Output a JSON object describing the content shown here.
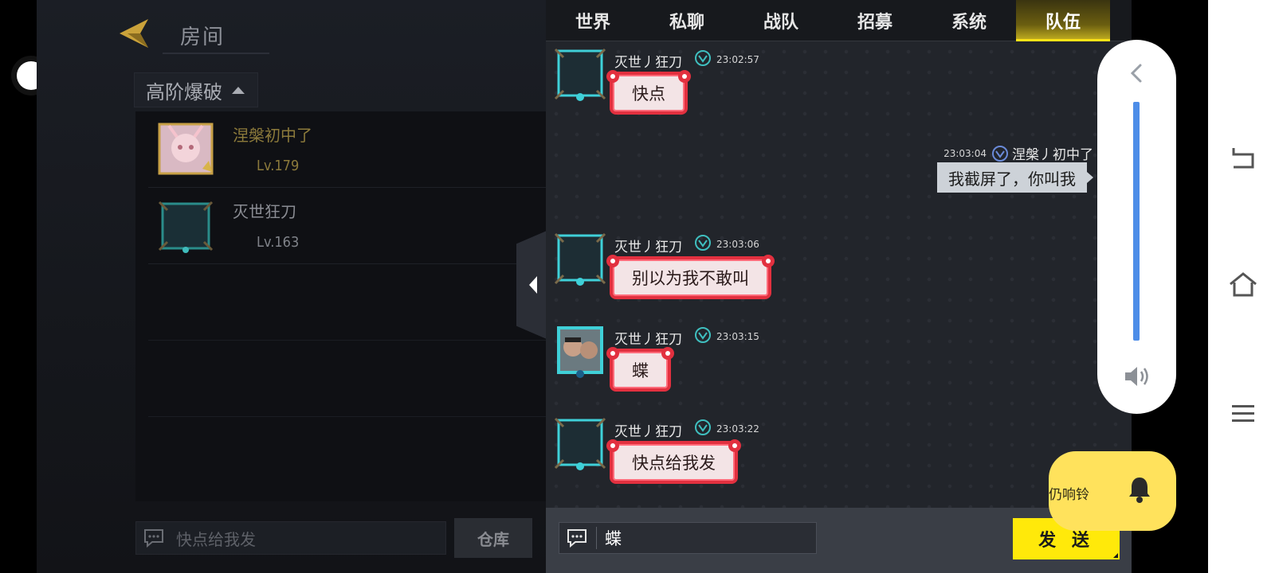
{
  "room": {
    "title": "房间",
    "mode": "高阶爆破",
    "players": [
      {
        "name": "涅槃初中了",
        "level": "Lv.179",
        "highlight": true
      },
      {
        "name": "灭世狂刀",
        "level": "Lv.163",
        "highlight": false
      }
    ],
    "chat_text": "快点给我发",
    "storage_label": "仓库"
  },
  "chat": {
    "tabs": [
      {
        "label": "世界",
        "active": false
      },
      {
        "label": "私聊",
        "active": false
      },
      {
        "label": "战队",
        "active": false
      },
      {
        "label": "招募",
        "active": false
      },
      {
        "label": "系统",
        "active": false
      },
      {
        "label": "队伍",
        "active": true
      }
    ],
    "messages": [
      {
        "sender": "灭世丿狂刀",
        "time": "23:02:57",
        "text": "快点",
        "mine": false
      },
      {
        "sender": "涅槃丿初中了",
        "time": "23:03:04",
        "text": "我截屏了，你叫我",
        "mine": true
      },
      {
        "sender": "灭世丿狂刀",
        "time": "23:03:06",
        "text": "别以为我不敢叫",
        "mine": false
      },
      {
        "sender": "灭世丿狂刀",
        "time": "23:03:15",
        "text": "蝶",
        "mine": false
      },
      {
        "sender": "灭世丿狂刀",
        "time": "23:03:22",
        "text": "快点给我发",
        "mine": false
      }
    ],
    "input_value": "蝶",
    "send_label": "发 送"
  },
  "volume": {
    "level": 1.0,
    "icon": "speaker-icon"
  },
  "ring": {
    "label": "仍响铃",
    "icon": "bell-icon"
  },
  "navbar": {
    "icons": [
      "back-icon",
      "home-icon",
      "menu-icon"
    ]
  },
  "colors": {
    "accent_yellow": "#ffe90a",
    "bubble_red": "#e2303f",
    "volume_blue": "#4d8de8",
    "ring_yellow": "#ffe25c"
  }
}
